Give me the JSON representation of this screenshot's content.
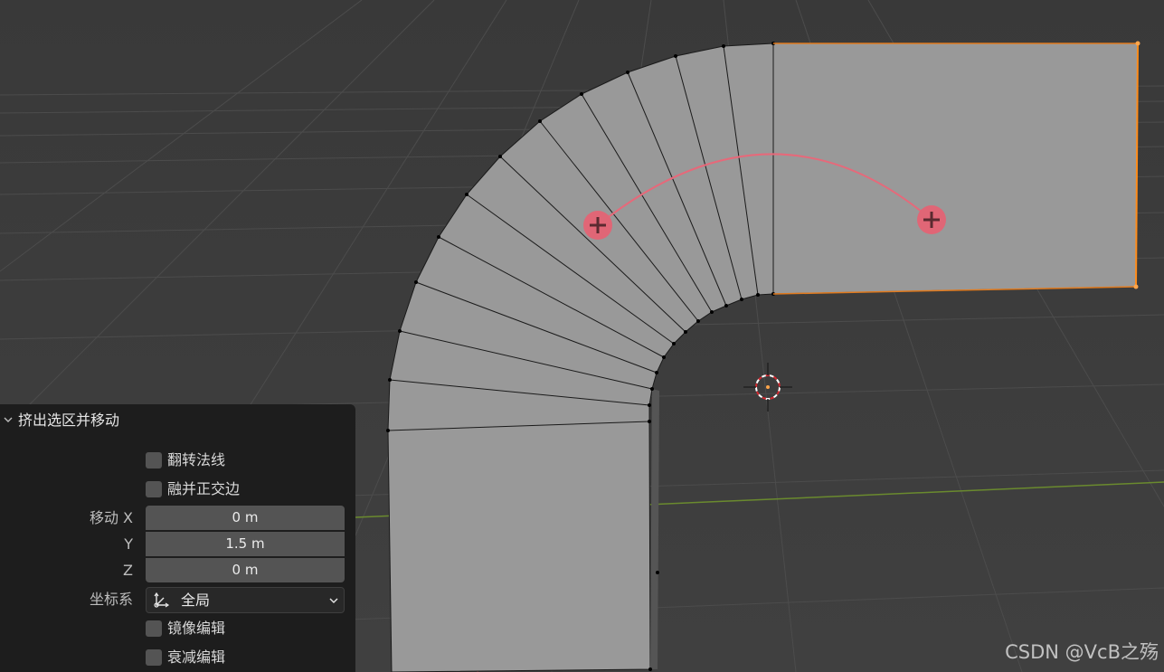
{
  "panel": {
    "title": "挤出选区并移动",
    "flip_normals": {
      "label": "翻转法线",
      "checked": false
    },
    "dissolve_orthogonal": {
      "label": "融并正交边",
      "checked": false
    },
    "move_label": "移动 X",
    "move_y_label": "Y",
    "move_z_label": "Z",
    "move_x_value": "0 m",
    "move_y_value": "1.5 m",
    "move_z_value": "0 m",
    "orientation_label": "坐标系",
    "orientation_value": "全局",
    "mirror_editing": {
      "label": "镜像编辑",
      "checked": false
    },
    "proportional_editing": {
      "label": "衰减编辑",
      "checked": false
    }
  },
  "watermark": "CSDN @VcB之殇",
  "colors": {
    "viewport_bg": "#3d3d3d",
    "mesh_face": "#999999",
    "selected_edge": "#ff8c1a",
    "curve": "#e6697a",
    "panel_bg": "#1d1d1d"
  }
}
